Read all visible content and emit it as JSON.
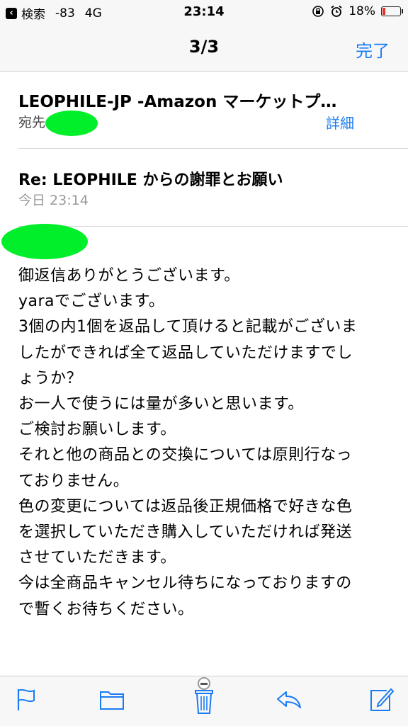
{
  "status_bar": {
    "back_label": "検索",
    "signal": "-83",
    "network": "4G",
    "time": "23:14",
    "battery_percent": "18%",
    "battery_level": 0.18,
    "battery_color": "#e0362b"
  },
  "nav": {
    "title": "3/3",
    "done_label": "完了"
  },
  "header": {
    "sender": "LEOPHILE-JP -Amazon マーケットプ…",
    "to_label": "宛先",
    "detail_label": "詳細"
  },
  "message": {
    "subject": "Re: LEOPHILE からの謝罪とお願い",
    "date": "今日 23:14",
    "body_lines": [
      "御返信ありがとうございます。",
      "yaraでございます。",
      "3個の内1個を返品して頂けると記載がございま",
      "したができれば全て返品していただけますでし",
      "ょうか？",
      "お一人で使うには量が多いと思います。",
      "ご検討お願いします。",
      "それと他の商品との交換については原則行なっ",
      "ておりません。",
      "色の変更については返品後正規価格で好きな色",
      "を選択していただき購入していただければ発送",
      "させていただきます。",
      "今は全商品キャンセル待ちになっておりますの",
      "で暫くお待ちください。"
    ]
  },
  "toolbar": {
    "icons": [
      "flag-icon",
      "folder-icon",
      "trash-icon",
      "reply-icon",
      "compose-icon"
    ]
  },
  "colors": {
    "accent": "#1a7cf2",
    "redaction": "#00ef2a"
  }
}
